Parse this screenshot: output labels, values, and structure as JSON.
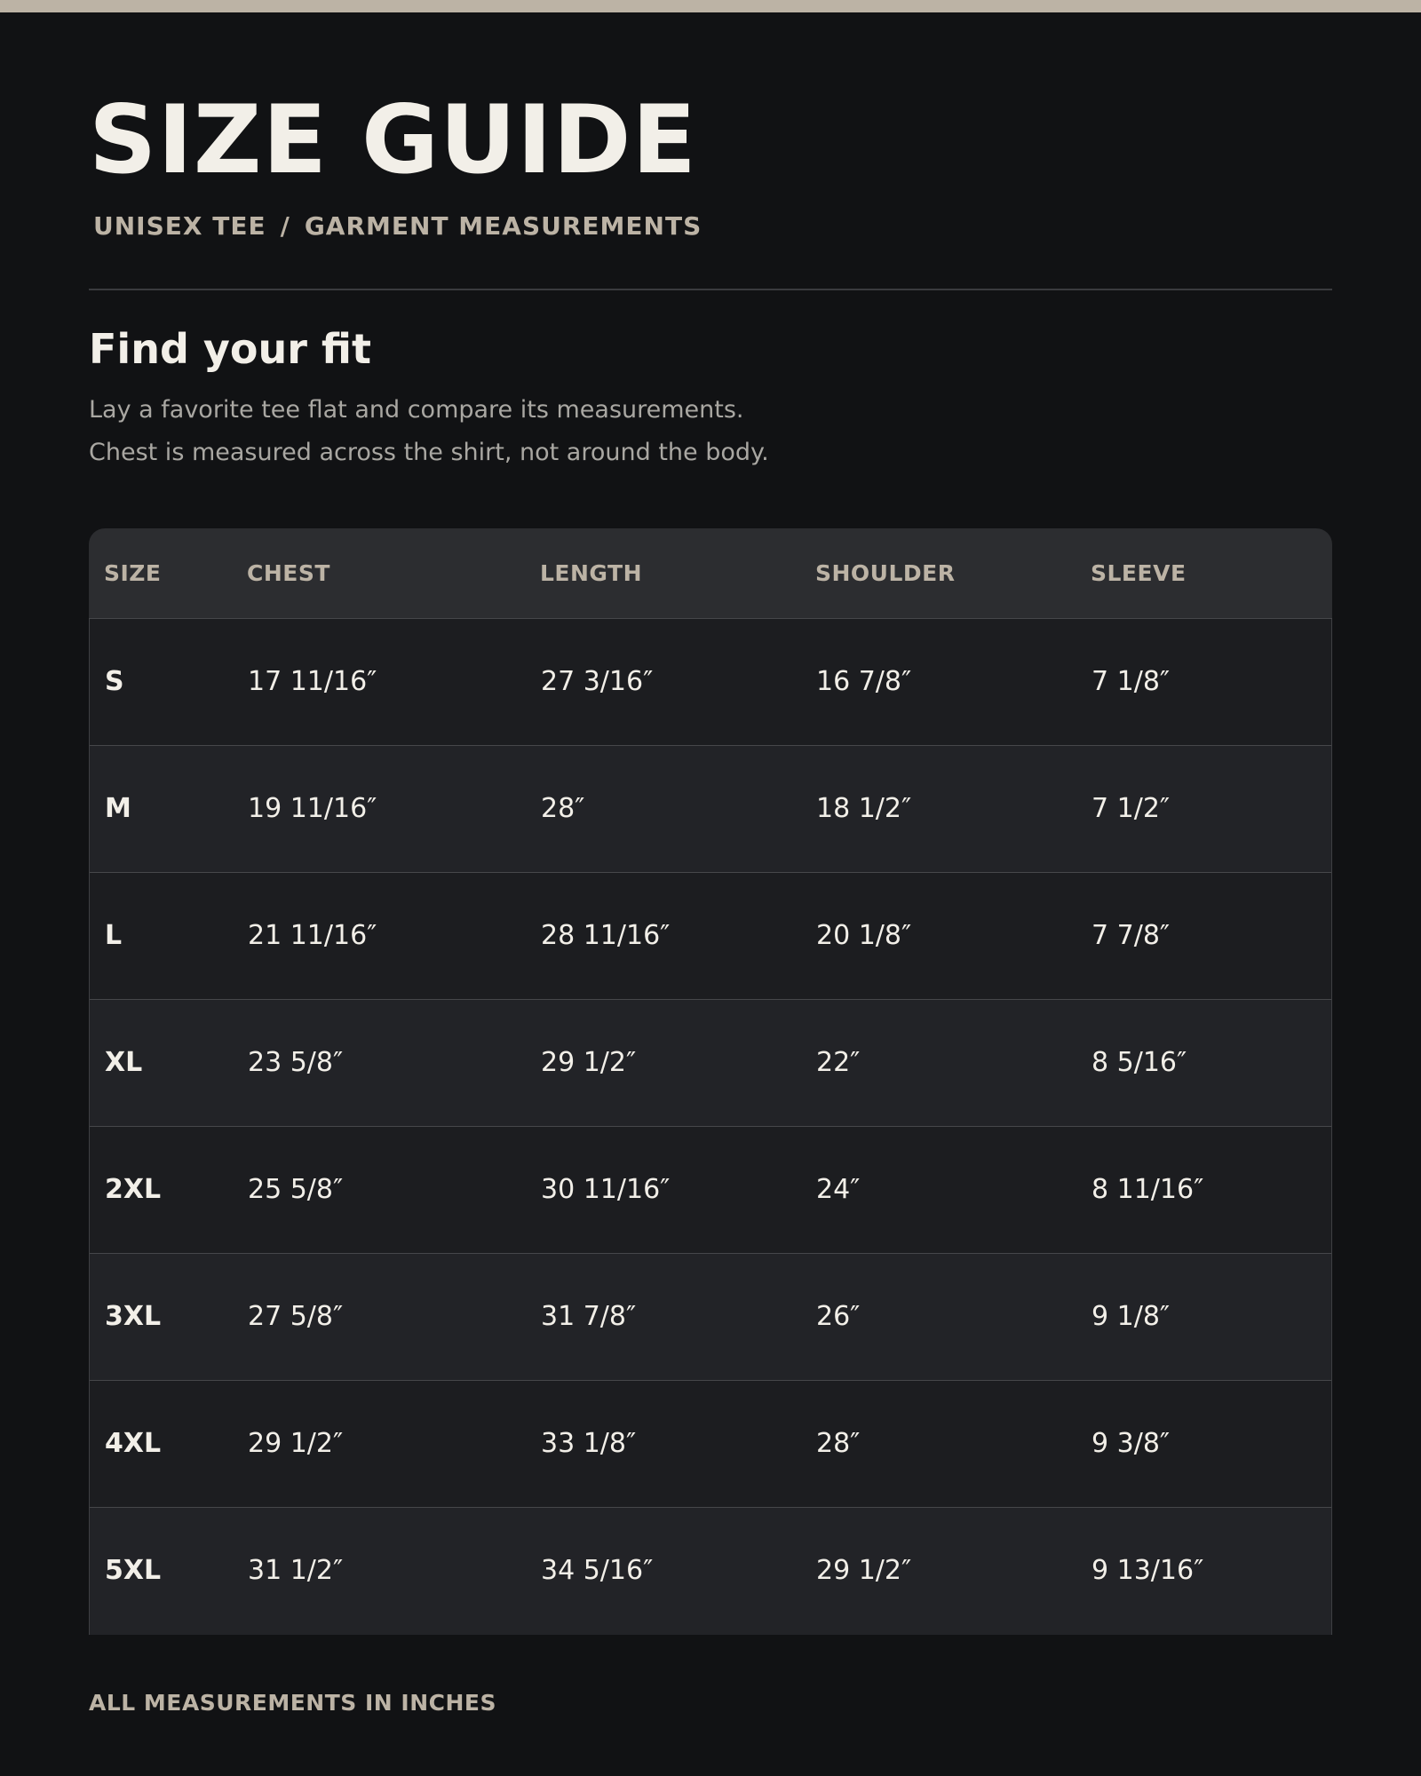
{
  "colors": {
    "background": "#111214",
    "accent": "#bcb3a5",
    "text": "#f2efe8",
    "muted_text": "#a9a7a2",
    "table_header_bg": "#2c2d30",
    "row_bg_a": "#1c1d20",
    "row_bg_b": "#222327"
  },
  "header": {
    "title": "SIZE GUIDE",
    "subtitle_left": "UNISEX TEE",
    "subtitle_separator": "/",
    "subtitle_right": "GARMENT MEASUREMENTS"
  },
  "intro": {
    "heading": "Find your fit",
    "line1": "Lay a favorite tee flat and compare its measurements.",
    "line2": "Chest is measured across the shirt, not around the body."
  },
  "table": {
    "columns": [
      "SIZE",
      "CHEST",
      "LENGTH",
      "SHOULDER",
      "SLEEVE"
    ],
    "rows": [
      {
        "size": "S",
        "chest": "17 11/16″",
        "length": "27 3/16″",
        "shoulder": "16 7/8″",
        "sleeve": "7 1/8″"
      },
      {
        "size": "M",
        "chest": "19 11/16″",
        "length": "28″",
        "shoulder": "18 1/2″",
        "sleeve": "7 1/2″"
      },
      {
        "size": "L",
        "chest": "21 11/16″",
        "length": "28 11/16″",
        "shoulder": "20 1/8″",
        "sleeve": "7 7/8″"
      },
      {
        "size": "XL",
        "chest": "23 5/8″",
        "length": "29 1/2″",
        "shoulder": "22″",
        "sleeve": "8 5/16″"
      },
      {
        "size": "2XL",
        "chest": "25 5/8″",
        "length": "30 11/16″",
        "shoulder": "24″",
        "sleeve": "8 11/16″"
      },
      {
        "size": "3XL",
        "chest": "27 5/8″",
        "length": "31 7/8″",
        "shoulder": "26″",
        "sleeve": "9 1/8″"
      },
      {
        "size": "4XL",
        "chest": "29 1/2″",
        "length": "33 1/8″",
        "shoulder": "28″",
        "sleeve": "9 3/8″"
      },
      {
        "size": "5XL",
        "chest": "31 1/2″",
        "length": "34 5/16″",
        "shoulder": "29 1/2″",
        "sleeve": "9 13/16″"
      }
    ]
  },
  "footer": {
    "note": "ALL MEASUREMENTS IN INCHES"
  }
}
